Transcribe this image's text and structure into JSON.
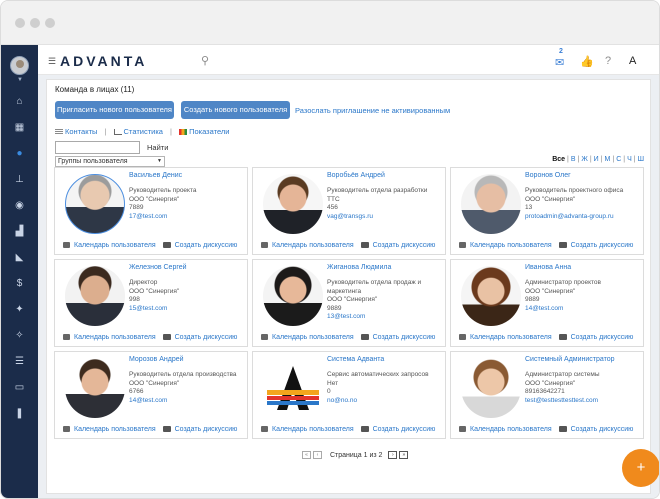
{
  "header": {
    "logo": "ADVANTA",
    "mail_count": "2"
  },
  "team": {
    "title": "Команда в лицах (11)",
    "invite_button": "Пригласить нового пользователя",
    "create_button": "Создать нового пользователя",
    "resend_link": "Разослать приглашение не активированным",
    "tabs": [
      "Контакты",
      "Статистика",
      "Показатели"
    ],
    "search_placeholder": "",
    "find_label": "Найти",
    "group_select": "Группы пользователя",
    "alphabet": [
      "Все",
      "В",
      "Ж",
      "И",
      "М",
      "С",
      "Ч",
      "Ш"
    ]
  },
  "card_actions": {
    "calendar": "Календарь пользователя",
    "discussion": "Создать дискуссию"
  },
  "cards": [
    {
      "name": "Васильев Денис",
      "lines": [
        "Руководитель проекта",
        "ООО \"Синергия\"",
        "7889"
      ],
      "email": "17@test.com"
    },
    {
      "name": "Воробьёв Андрей",
      "lines": [
        "Руководитель отдела разработки",
        "ТТС",
        "456"
      ],
      "email": "vag@transgs.ru"
    },
    {
      "name": "Воронов Олег",
      "lines": [
        "Руководитель проектного офиса",
        "ООО \"Синергия\"",
        "13"
      ],
      "email": "protoadmin@advanta-group.ru"
    },
    {
      "name": "Железнов Сергей",
      "lines": [
        "Директор",
        "ООО \"Синергия\"",
        "998"
      ],
      "email": "15@test.com"
    },
    {
      "name": "Жиганова Людмила",
      "lines": [
        "Руководитель отдела продаж и",
        "маркетинга",
        "ООО \"Синергия\"",
        "9889"
      ],
      "email": "13@test.com"
    },
    {
      "name": "Иванова Анна",
      "lines": [
        "Администратор проектов",
        "ООО \"Синергия\"",
        "9889"
      ],
      "email": "14@test.com"
    },
    {
      "name": "Морозов Андрей",
      "lines": [
        "Руководитель отдела производства",
        "ООО \"Синергия\"",
        "6766"
      ],
      "email": "14@test.com"
    },
    {
      "name": "Система Адванта",
      "lines": [
        "Сервис автоматических запросов",
        "Нет",
        "0"
      ],
      "email": "no@no.no"
    },
    {
      "name": "Системный Администратор",
      "lines": [
        "Администратор системы",
        "ООО \"Синергия\"",
        "89163642271"
      ],
      "email": "test@testtesttesttest.com"
    }
  ],
  "pager": {
    "text": "Страница 1 из 2"
  }
}
